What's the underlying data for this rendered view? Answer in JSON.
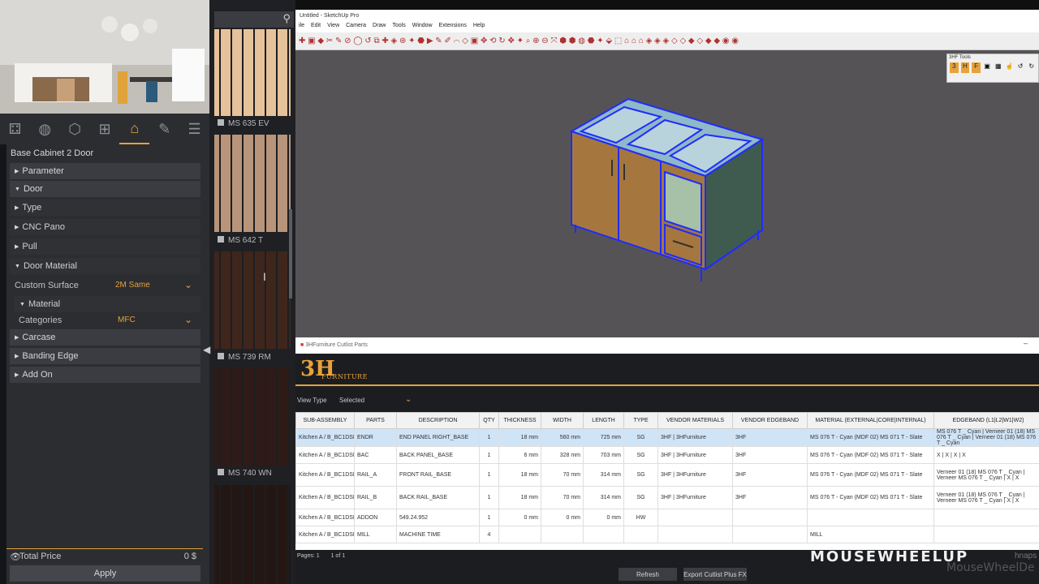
{
  "left": {
    "tabs": [
      "parts-icon",
      "sphere-icon",
      "cube-icon",
      "tree-icon",
      "home-icon",
      "edit-icon",
      "list-icon"
    ],
    "product_title": "Base Cabinet 2 Door",
    "sections": {
      "parameter": "Parameter",
      "door": "Door",
      "type": "Type",
      "cnc_pano": "CNC Pano",
      "pull": "Pull",
      "door_material": "Door Material",
      "custom_surface_label": "Custom Surface",
      "custom_surface_value": "2M Same",
      "material": "Material",
      "categories_label": "Categories",
      "categories_value": "MFC",
      "carcase": "Carcase",
      "banding_edge": "Banding Edge",
      "add_on": "Add On"
    },
    "total_label": "Total Price",
    "total_value": "0 $",
    "apply": "Apply"
  },
  "swatches": [
    {
      "label": "MS 635 EV",
      "color": "#e6c29a"
    },
    {
      "label": "MS 642 T",
      "color": "#b8957a"
    },
    {
      "label": "MS 739 RM",
      "color": "#3f261c"
    },
    {
      "label": "MS 740 WN",
      "color": "#2e1a16"
    },
    {
      "label": "",
      "color": "#241612"
    }
  ],
  "sketchup": {
    "title": "Untitled - SketchUp Pro",
    "menu": [
      "ile",
      "Edit",
      "View",
      "Camera",
      "Draw",
      "Tools",
      "Window",
      "Extensions",
      "Help"
    ],
    "tools_panel_title": "3HF Tools"
  },
  "cutlist": {
    "window_title": "3HFurniture Cutlist Parts",
    "logo": "3H",
    "brand": "FURNITURE",
    "view_type_label": "View Type",
    "view_type_value": "Selected",
    "columns": [
      "SUB-ASSEMBLY",
      "PARTS",
      "DESCRIPTION",
      "QTY",
      "THICKNESS",
      "WIDTH",
      "LENGTH",
      "TYPE",
      "VENDOR MATERIALS",
      "VENDOR EDGEBAND",
      "MATERIAL (EXTERNAL|CORE|INTERNAL)",
      "EDGEBAND (L1|L2|W1|W2)"
    ],
    "rows": [
      [
        "Kitchen A / B_BC1DSH",
        "ENDR",
        "END PANEL RIGHT_BASE",
        "1",
        "18 mm",
        "560 mm",
        "725 mm",
        "SG",
        "3HF | 3HFurniture",
        "3HF",
        "MS 076 T - Cyan (MDF 02) MS 071 T - Slate",
        "MS 076 T _ Cyan | Verneer 01 (18) MS 076 T _ Cyan | Verneer 01 (18) MS 076 T _ Cyan"
      ],
      [
        "Kitchen A / B_BC1DSH",
        "BAC",
        "BACK PANEL_BASE",
        "1",
        "6 mm",
        "328 mm",
        "703 mm",
        "SG",
        "3HF | 3HFurniture",
        "3HF",
        "MS 076 T - Cyan (MDF 02) MS 071 T - Slate",
        "X | X | X | X"
      ],
      [
        "Kitchen A / B_BC1DSH",
        "RAIL_A",
        "FRONT RAIL_BASE",
        "1",
        "18 mm",
        "70 mm",
        "314 mm",
        "SG",
        "3HF | 3HFurniture",
        "3HF",
        "MS 076 T - Cyan (MDF 02) MS 071 T - Slate",
        "Verneer 01 (18) MS 076 T _ Cyan | Verneer MS 076 T _ Cyan | X | X"
      ],
      [
        "Kitchen A / B_BC1DSH",
        "RAIL_B",
        "BACK RAIL_BASE",
        "1",
        "18 mm",
        "70 mm",
        "314 mm",
        "SG",
        "3HF | 3HFurniture",
        "3HF",
        "MS 076 T - Cyan (MDF 02) MS 071 T - Slate",
        "Verneer 01 (18) MS 076 T _ Cyan | Verneer MS 076 T _ Cyan | X | X"
      ],
      [
        "Kitchen A / B_BC1DSH",
        "ADDON",
        "549.24.952",
        "1",
        "0 mm",
        "0 mm",
        "0 mm",
        "HW",
        "",
        "",
        "",
        ""
      ],
      [
        "Kitchen A / B_BC1DSHT",
        "MILL",
        "MACHINE TIME",
        "4",
        "",
        "",
        "",
        "",
        "",
        "",
        "MILL",
        ""
      ]
    ],
    "pager_label": "Pages: 1",
    "pager_value": "1 of 1",
    "refresh": "Refresh",
    "export": "Export Cutlist Plus FX"
  },
  "watermark": "MOUSEWHEELUP",
  "watermark_sub": "MouseWheelDe",
  "watermark_tail": "hnaps",
  "colors": {
    "accent": "#e6a23c",
    "panel": "#2b2d31",
    "viewport": "#565356",
    "selection": "#cfe4f7",
    "cabinet_outline": "#1f2cff"
  }
}
